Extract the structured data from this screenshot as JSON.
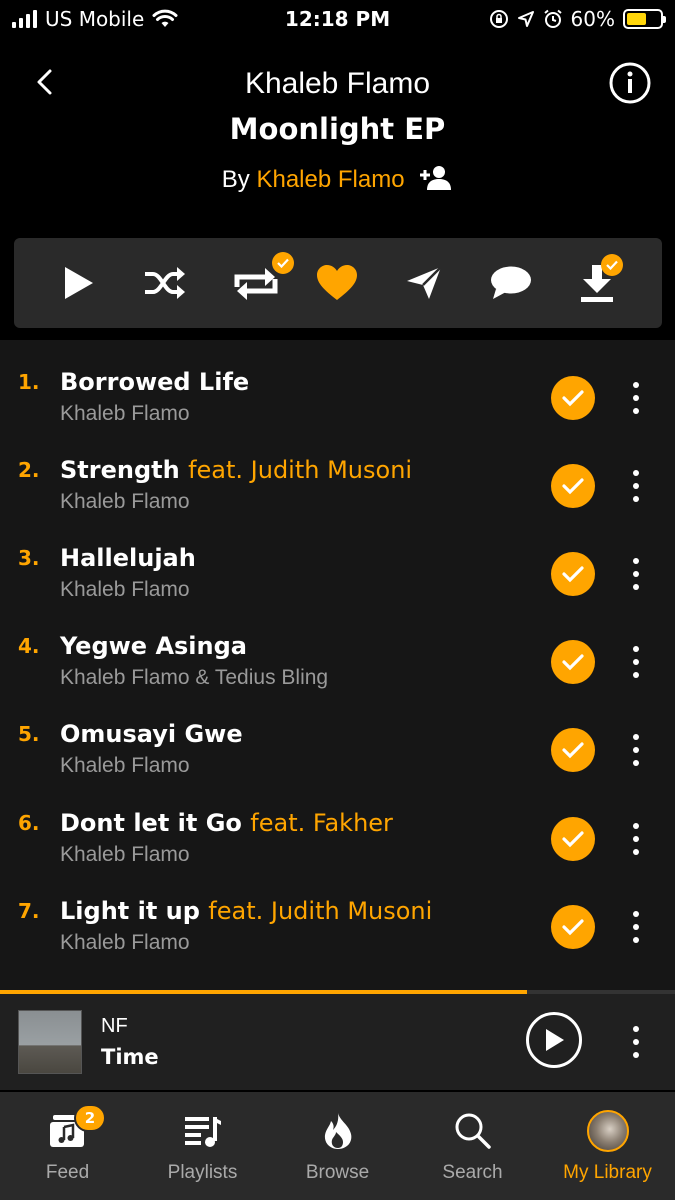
{
  "status_bar": {
    "carrier": "US Mobile",
    "time": "12:18 PM",
    "battery_percent": "60%",
    "battery_level": 0.6,
    "icons": [
      "signal-icon",
      "wifi-icon",
      "orientation-lock-icon",
      "location-icon",
      "alarm-icon",
      "battery-icon"
    ]
  },
  "header": {
    "artist": "Khaleb Flamo",
    "album": "Moonlight EP",
    "by_label": "By",
    "by_artist": "Khaleb Flamo",
    "icons": [
      "back-icon",
      "info-icon",
      "follow-icon"
    ]
  },
  "actions": [
    "play-icon",
    "shuffle-icon",
    "repeat-icon",
    "heart-icon",
    "share-icon",
    "comment-icon",
    "download-icon"
  ],
  "tracks": [
    {
      "num": "1.",
      "title": "Borrowed Life",
      "feat": "",
      "artist": "Khaleb Flamo"
    },
    {
      "num": "2.",
      "title": "Strength",
      "feat": "feat. Judith Musoni",
      "artist": "Khaleb Flamo"
    },
    {
      "num": "3.",
      "title": "Hallelujah",
      "feat": "",
      "artist": "Khaleb Flamo"
    },
    {
      "num": "4.",
      "title": "Yegwe Asinga",
      "feat": "",
      "artist": "Khaleb Flamo & Tedius Bling"
    },
    {
      "num": "5.",
      "title": "Omusayi Gwe",
      "feat": "",
      "artist": "Khaleb Flamo"
    },
    {
      "num": "6.",
      "title": "Dont let it Go",
      "feat": "feat. Fakher",
      "artist": "Khaleb Flamo"
    },
    {
      "num": "7.",
      "title": "Light it up",
      "feat": "feat. Judith Musoni",
      "artist": "Khaleb Flamo"
    }
  ],
  "now_playing": {
    "artist": "NF",
    "song": "Time",
    "progress": 0.78
  },
  "tabs": [
    {
      "label": "Feed",
      "badge": "2",
      "icon": "feed-icon"
    },
    {
      "label": "Playlists",
      "icon": "playlists-icon"
    },
    {
      "label": "Browse",
      "icon": "flame-icon"
    },
    {
      "label": "Search",
      "icon": "search-icon"
    },
    {
      "label": "My Library",
      "icon": "avatar",
      "active": true
    }
  ],
  "colors": {
    "accent": "#ffa500",
    "background": "#000000",
    "list_bg": "#161616",
    "bar_bg": "#2a2a2a"
  }
}
